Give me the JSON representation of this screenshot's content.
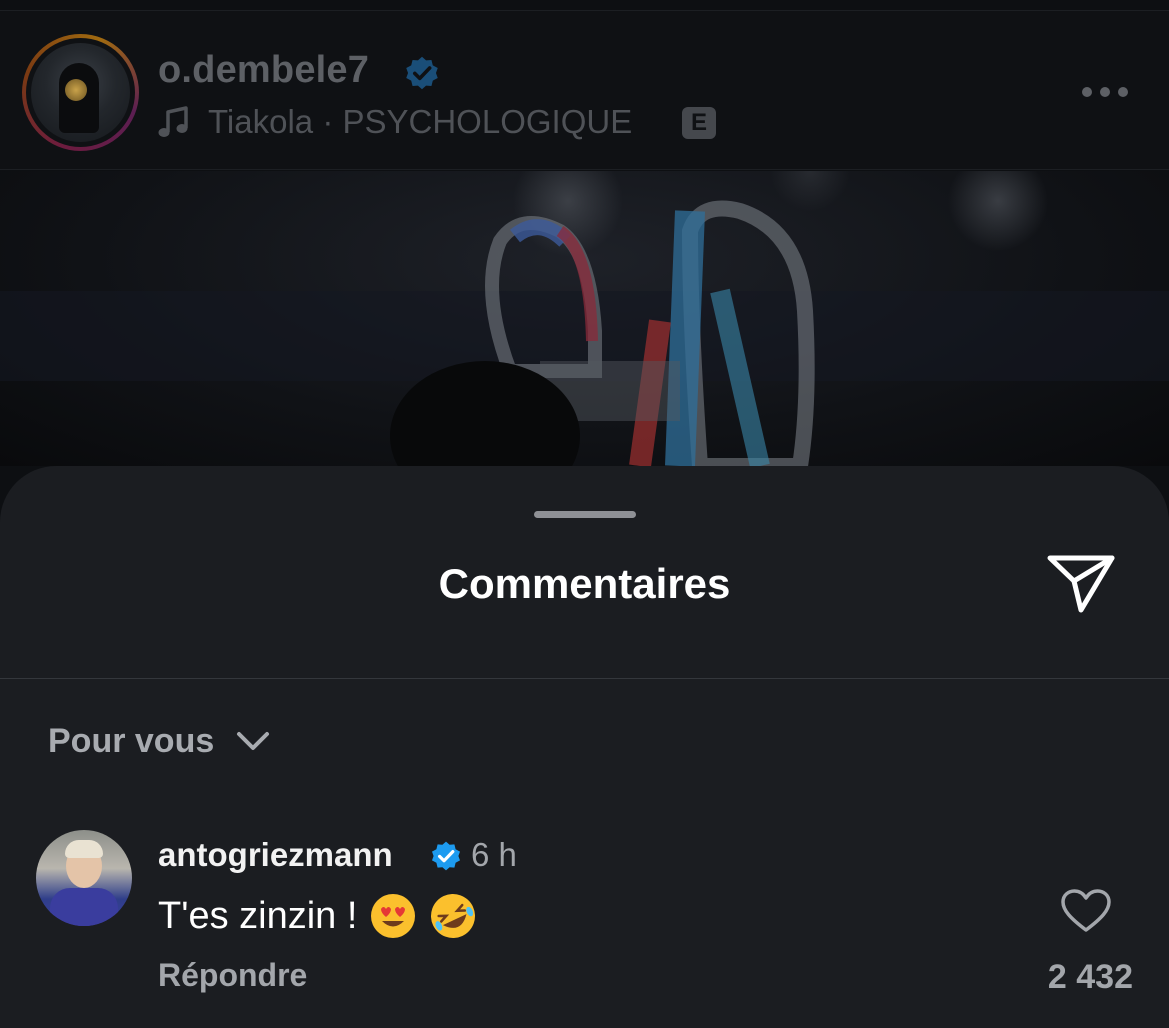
{
  "post": {
    "username": "o.dembele7",
    "song": "Tiakola · PSYCHOLOGIQUE",
    "explicit_badge": "E",
    "icons": {
      "verified": "verified-badge-icon",
      "music": "music-note-icon",
      "more": "more-options-icon"
    }
  },
  "comments_sheet": {
    "title": "Commentaires",
    "share_icon": "paper-plane-icon",
    "sort_label": "Pour vous",
    "sort_icon": "chevron-down-icon"
  },
  "comments": [
    {
      "username": "antogriezmann",
      "time": "6 h",
      "text": "T'es zinzin !",
      "emojis": [
        "heart-eyes-emoji",
        "rolling-laughing-emoji"
      ],
      "reply_label": "Répondre",
      "likes": "2 432"
    }
  ],
  "colors": {
    "verified_blue": "#1d9bf0",
    "sheet_bg": "#1b1d21"
  }
}
